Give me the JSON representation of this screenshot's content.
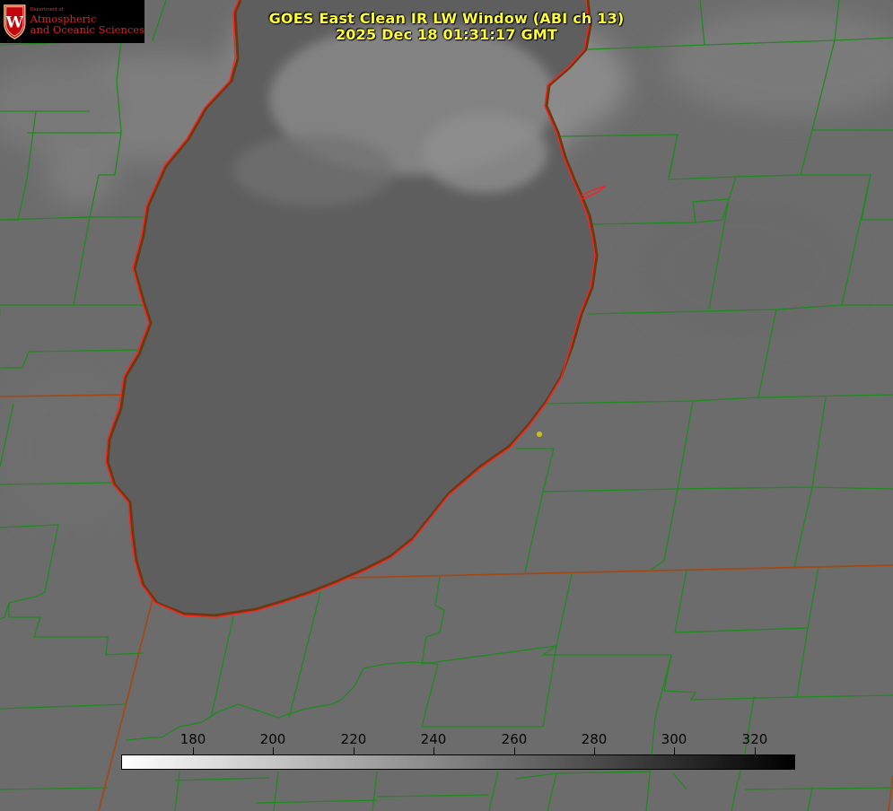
{
  "title": {
    "line1": "GOES East Clean IR LW Window (ABI ch 13)",
    "line2": "2025 Dec 18 01:31:17 GMT"
  },
  "logo": {
    "dept": "Department of",
    "line1": "Atmospheric",
    "line2": "and Oceanic Sciences",
    "crest_letter": "W",
    "crest_color": "#c5050c"
  },
  "colorbar": {
    "ticks": [
      "180",
      "200",
      "220",
      "240",
      "260",
      "280",
      "300",
      "320"
    ],
    "min_color": "#ffffff",
    "max_color": "#000000"
  },
  "colors": {
    "background": "#6a6a6a",
    "lake": "#5c5c5c",
    "county_lines": "#1f8a1f",
    "state_lines": "#a04a1a",
    "shoreline": "#ff2020",
    "marker": "#c8c020",
    "title": "#ffff33"
  },
  "icons": {
    "marker": "station-dot-icon",
    "crest": "uw-crest-icon"
  }
}
